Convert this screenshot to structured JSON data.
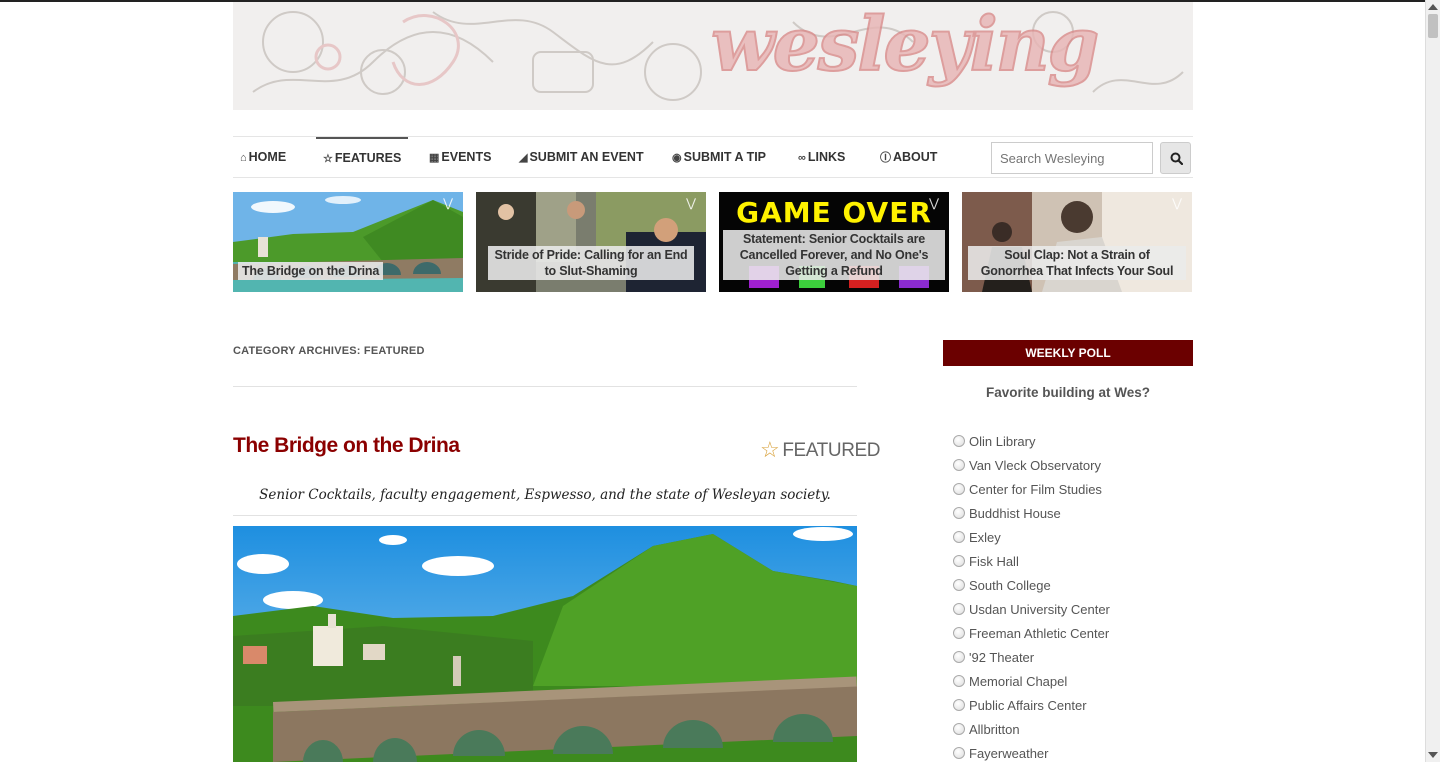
{
  "site": {
    "logo_text": "wesleying"
  },
  "nav": {
    "items": [
      {
        "label": "HOME",
        "icon": "home-icon"
      },
      {
        "label": "FEATURES",
        "icon": "star-icon",
        "active": true
      },
      {
        "label": "EVENTS",
        "icon": "calendar-icon"
      },
      {
        "label": "SUBMIT AN EVENT",
        "icon": "bullhorn-icon"
      },
      {
        "label": "SUBMIT A TIP",
        "icon": "eye-icon"
      },
      {
        "label": "LINKS",
        "icon": "link-icon"
      },
      {
        "label": "ABOUT",
        "icon": "info-icon"
      }
    ],
    "search_placeholder": "Search Wesleying"
  },
  "slides": [
    {
      "caption": "The Bridge on the Drina"
    },
    {
      "caption": "Stride of Pride: Calling for an End to Slut-Shaming"
    },
    {
      "caption": "Statement: Senior Cocktails are Cancelled Forever, and No One's Getting a Refund",
      "image_text": "GAME OVER"
    },
    {
      "caption": "Soul Clap: Not a Strain of Gonorrhea That Infects Your Soul"
    }
  ],
  "archive": {
    "title": "CATEGORY ARCHIVES: FEATURED"
  },
  "post": {
    "title": "The Bridge on the Drina",
    "category": "FEATURED",
    "subtitle": "Senior Cocktails, faculty engagement, Espwesso, and the state of Wesleyan society."
  },
  "poll": {
    "heading": "WEEKLY POLL",
    "question": "Favorite building at Wes?",
    "options": [
      "Olin Library",
      "Van Vleck Observatory",
      "Center for Film Studies",
      "Buddhist House",
      "Exley",
      "Fisk Hall",
      "South College",
      "Usdan University Center",
      "Freeman Athletic Center",
      "'92 Theater",
      "Memorial Chapel",
      "Public Affairs Center",
      "Allbritton",
      "Fayerweather"
    ]
  },
  "colors": {
    "accent": "#8b0000",
    "poll_header": "#6b0000",
    "featured_star": "#d9a441"
  }
}
